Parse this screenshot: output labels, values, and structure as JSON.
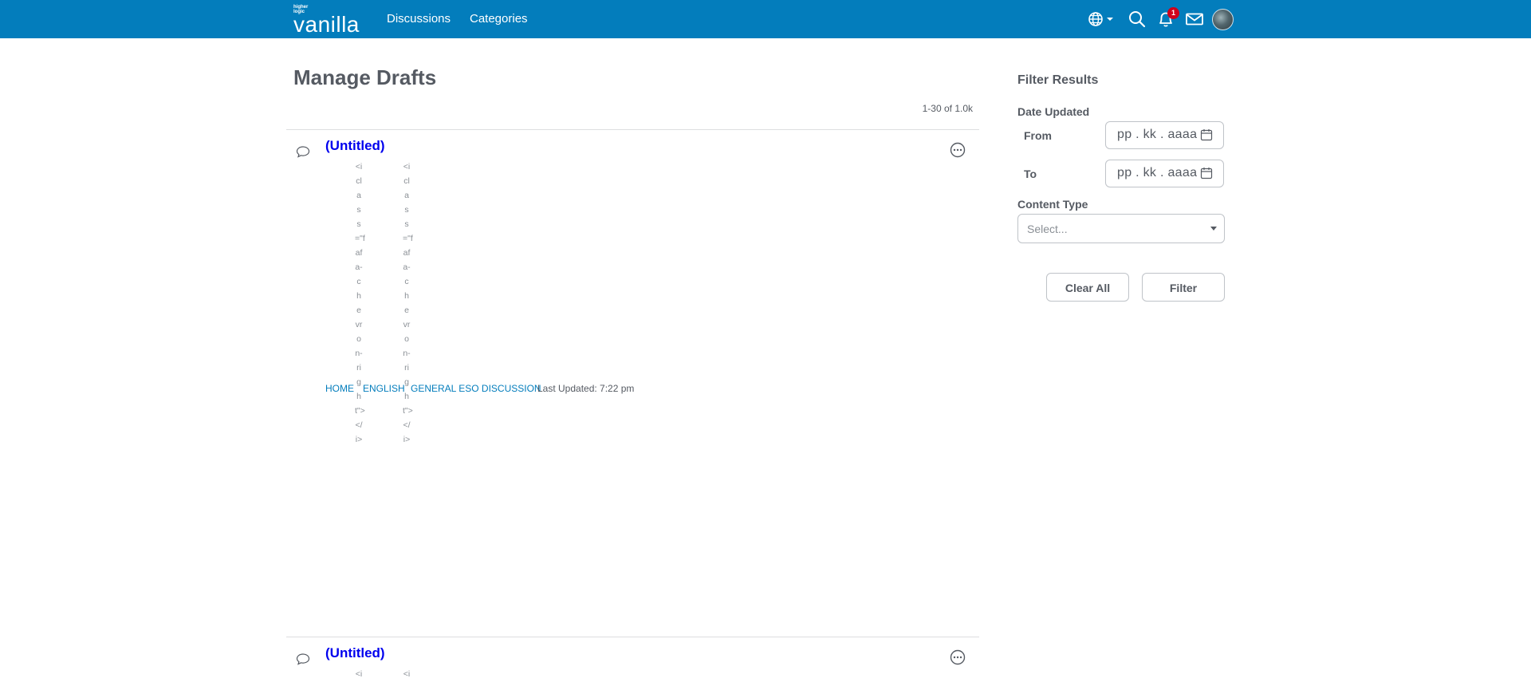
{
  "header": {
    "logo_tagline": "higher logic",
    "logo_word": "vanilla",
    "nav": [
      "Discussions",
      "Categories"
    ],
    "notification_count": "1",
    "icons": [
      "globe-icon",
      "chevron-down-icon",
      "search-icon",
      "bell-icon",
      "mail-icon",
      "avatar"
    ],
    "colors": {
      "brand": "#037dbc",
      "badge": "#d0021b",
      "link": "#037dbc",
      "title_link": "#0000ee"
    }
  },
  "main": {
    "title": "Manage Drafts",
    "pager": "1-30 of 1.0k",
    "drafts": [
      {
        "title": "(Untitled)",
        "breadcrumbs": [
          "HOME",
          "ENGLISH",
          "GENERAL ESO DISCUSSION"
        ],
        "separator_markup": "<iclass=\"fafa-chevron-right\"></i>",
        "last_updated": "Last Updated: 7:22 pm"
      },
      {
        "title": "(Untitled)",
        "separator_markup": "<i"
      }
    ]
  },
  "sidebar": {
    "heading": "Filter Results",
    "date_label": "Date Updated",
    "from_label": "From",
    "to_label": "To",
    "date_placeholder": "pp . kk . aaaa",
    "content_type_label": "Content Type",
    "content_type_placeholder": "Select...",
    "clear_label": "Clear All",
    "filter_label": "Filter"
  }
}
